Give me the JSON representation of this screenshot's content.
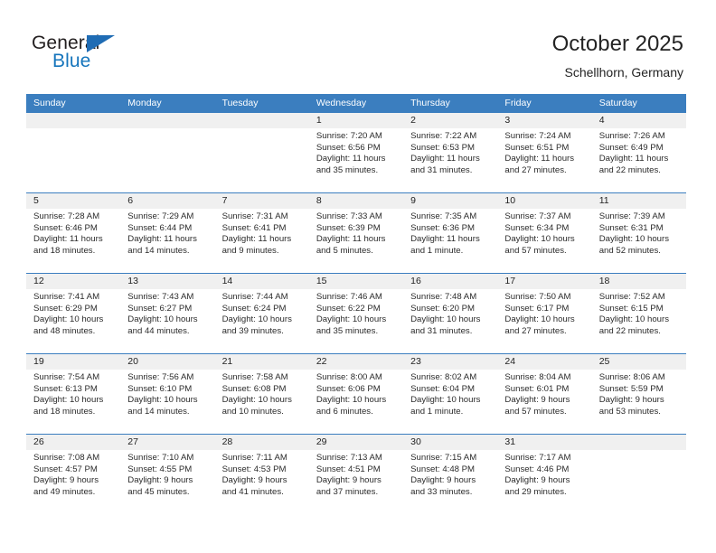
{
  "brand": {
    "name_top": "General",
    "name_bottom": "Blue",
    "triangle_color": "#1f6cb4",
    "text_color": "#231f20",
    "blue_color": "#1675bc"
  },
  "header": {
    "month_title": "October 2025",
    "location": "Schellhorn, Germany"
  },
  "theme": {
    "header_row_bg": "#3b7ebf",
    "header_row_text": "#ffffff",
    "week_divider": "#3b7ebf",
    "day_band_bg": "#f0f0f0",
    "body_text": "#2b2b2b"
  },
  "weekday_headers": [
    "Sunday",
    "Monday",
    "Tuesday",
    "Wednesday",
    "Thursday",
    "Friday",
    "Saturday"
  ],
  "weeks": [
    [
      {
        "day": "",
        "lines": []
      },
      {
        "day": "",
        "lines": []
      },
      {
        "day": "",
        "lines": []
      },
      {
        "day": "1",
        "lines": [
          "Sunrise: 7:20 AM",
          "Sunset: 6:56 PM",
          "Daylight: 11 hours",
          "and 35 minutes."
        ]
      },
      {
        "day": "2",
        "lines": [
          "Sunrise: 7:22 AM",
          "Sunset: 6:53 PM",
          "Daylight: 11 hours",
          "and 31 minutes."
        ]
      },
      {
        "day": "3",
        "lines": [
          "Sunrise: 7:24 AM",
          "Sunset: 6:51 PM",
          "Daylight: 11 hours",
          "and 27 minutes."
        ]
      },
      {
        "day": "4",
        "lines": [
          "Sunrise: 7:26 AM",
          "Sunset: 6:49 PM",
          "Daylight: 11 hours",
          "and 22 minutes."
        ]
      }
    ],
    [
      {
        "day": "5",
        "lines": [
          "Sunrise: 7:28 AM",
          "Sunset: 6:46 PM",
          "Daylight: 11 hours",
          "and 18 minutes."
        ]
      },
      {
        "day": "6",
        "lines": [
          "Sunrise: 7:29 AM",
          "Sunset: 6:44 PM",
          "Daylight: 11 hours",
          "and 14 minutes."
        ]
      },
      {
        "day": "7",
        "lines": [
          "Sunrise: 7:31 AM",
          "Sunset: 6:41 PM",
          "Daylight: 11 hours",
          "and 9 minutes."
        ]
      },
      {
        "day": "8",
        "lines": [
          "Sunrise: 7:33 AM",
          "Sunset: 6:39 PM",
          "Daylight: 11 hours",
          "and 5 minutes."
        ]
      },
      {
        "day": "9",
        "lines": [
          "Sunrise: 7:35 AM",
          "Sunset: 6:36 PM",
          "Daylight: 11 hours",
          "and 1 minute."
        ]
      },
      {
        "day": "10",
        "lines": [
          "Sunrise: 7:37 AM",
          "Sunset: 6:34 PM",
          "Daylight: 10 hours",
          "and 57 minutes."
        ]
      },
      {
        "day": "11",
        "lines": [
          "Sunrise: 7:39 AM",
          "Sunset: 6:31 PM",
          "Daylight: 10 hours",
          "and 52 minutes."
        ]
      }
    ],
    [
      {
        "day": "12",
        "lines": [
          "Sunrise: 7:41 AM",
          "Sunset: 6:29 PM",
          "Daylight: 10 hours",
          "and 48 minutes."
        ]
      },
      {
        "day": "13",
        "lines": [
          "Sunrise: 7:43 AM",
          "Sunset: 6:27 PM",
          "Daylight: 10 hours",
          "and 44 minutes."
        ]
      },
      {
        "day": "14",
        "lines": [
          "Sunrise: 7:44 AM",
          "Sunset: 6:24 PM",
          "Daylight: 10 hours",
          "and 39 minutes."
        ]
      },
      {
        "day": "15",
        "lines": [
          "Sunrise: 7:46 AM",
          "Sunset: 6:22 PM",
          "Daylight: 10 hours",
          "and 35 minutes."
        ]
      },
      {
        "day": "16",
        "lines": [
          "Sunrise: 7:48 AM",
          "Sunset: 6:20 PM",
          "Daylight: 10 hours",
          "and 31 minutes."
        ]
      },
      {
        "day": "17",
        "lines": [
          "Sunrise: 7:50 AM",
          "Sunset: 6:17 PM",
          "Daylight: 10 hours",
          "and 27 minutes."
        ]
      },
      {
        "day": "18",
        "lines": [
          "Sunrise: 7:52 AM",
          "Sunset: 6:15 PM",
          "Daylight: 10 hours",
          "and 22 minutes."
        ]
      }
    ],
    [
      {
        "day": "19",
        "lines": [
          "Sunrise: 7:54 AM",
          "Sunset: 6:13 PM",
          "Daylight: 10 hours",
          "and 18 minutes."
        ]
      },
      {
        "day": "20",
        "lines": [
          "Sunrise: 7:56 AM",
          "Sunset: 6:10 PM",
          "Daylight: 10 hours",
          "and 14 minutes."
        ]
      },
      {
        "day": "21",
        "lines": [
          "Sunrise: 7:58 AM",
          "Sunset: 6:08 PM",
          "Daylight: 10 hours",
          "and 10 minutes."
        ]
      },
      {
        "day": "22",
        "lines": [
          "Sunrise: 8:00 AM",
          "Sunset: 6:06 PM",
          "Daylight: 10 hours",
          "and 6 minutes."
        ]
      },
      {
        "day": "23",
        "lines": [
          "Sunrise: 8:02 AM",
          "Sunset: 6:04 PM",
          "Daylight: 10 hours",
          "and 1 minute."
        ]
      },
      {
        "day": "24",
        "lines": [
          "Sunrise: 8:04 AM",
          "Sunset: 6:01 PM",
          "Daylight: 9 hours",
          "and 57 minutes."
        ]
      },
      {
        "day": "25",
        "lines": [
          "Sunrise: 8:06 AM",
          "Sunset: 5:59 PM",
          "Daylight: 9 hours",
          "and 53 minutes."
        ]
      }
    ],
    [
      {
        "day": "26",
        "lines": [
          "Sunrise: 7:08 AM",
          "Sunset: 4:57 PM",
          "Daylight: 9 hours",
          "and 49 minutes."
        ]
      },
      {
        "day": "27",
        "lines": [
          "Sunrise: 7:10 AM",
          "Sunset: 4:55 PM",
          "Daylight: 9 hours",
          "and 45 minutes."
        ]
      },
      {
        "day": "28",
        "lines": [
          "Sunrise: 7:11 AM",
          "Sunset: 4:53 PM",
          "Daylight: 9 hours",
          "and 41 minutes."
        ]
      },
      {
        "day": "29",
        "lines": [
          "Sunrise: 7:13 AM",
          "Sunset: 4:51 PM",
          "Daylight: 9 hours",
          "and 37 minutes."
        ]
      },
      {
        "day": "30",
        "lines": [
          "Sunrise: 7:15 AM",
          "Sunset: 4:48 PM",
          "Daylight: 9 hours",
          "and 33 minutes."
        ]
      },
      {
        "day": "31",
        "lines": [
          "Sunrise: 7:17 AM",
          "Sunset: 4:46 PM",
          "Daylight: 9 hours",
          "and 29 minutes."
        ]
      },
      {
        "day": "",
        "lines": []
      }
    ]
  ]
}
